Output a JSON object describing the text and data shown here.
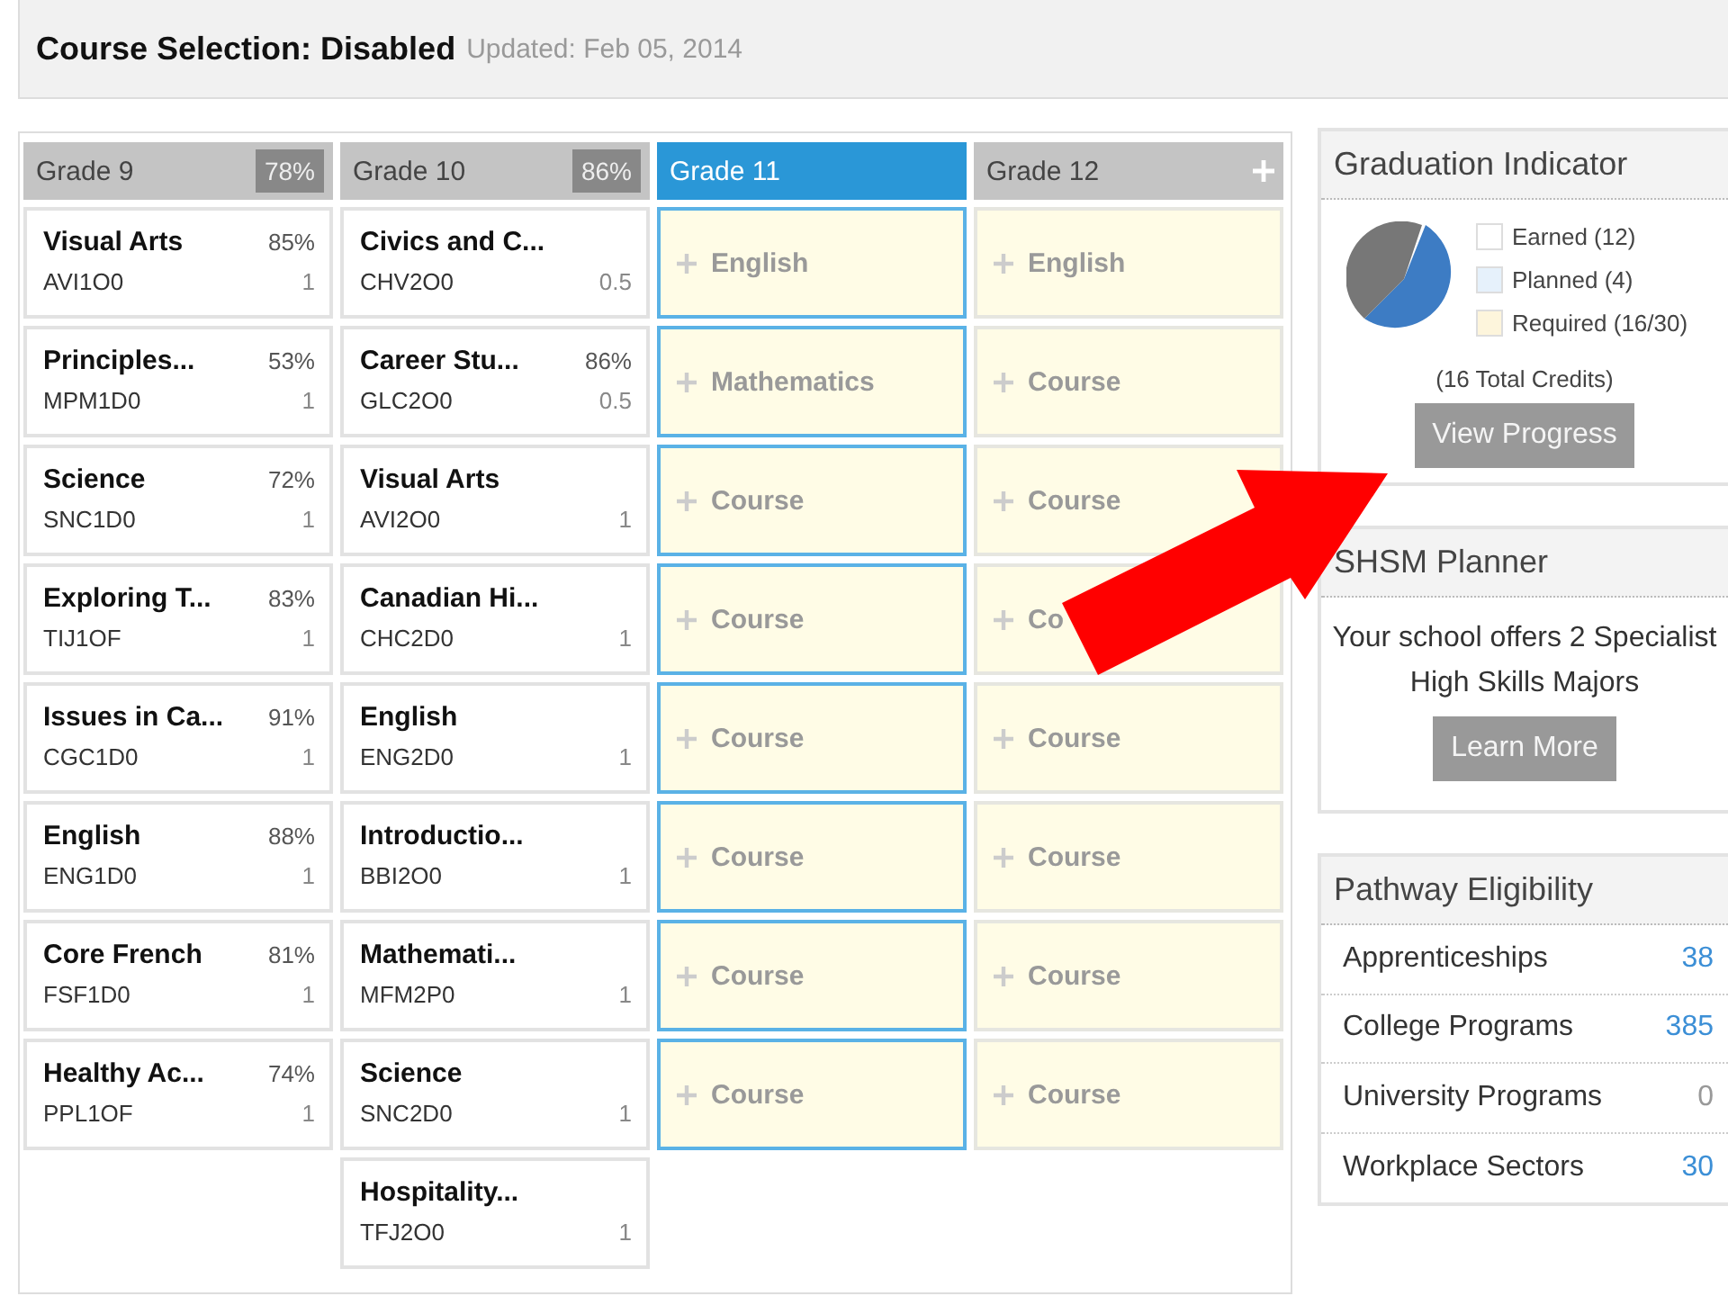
{
  "header": {
    "title": "Course Selection: Disabled",
    "updated": "Updated: Feb 05, 2014"
  },
  "grades": [
    {
      "label": "Grade 9",
      "percent": "78%",
      "selected": false,
      "can_add": false,
      "courses": [
        {
          "kind": "course",
          "name": "Visual Arts",
          "mark": "85%",
          "code": "AVI1O0",
          "credit": "1"
        },
        {
          "kind": "course",
          "name": "Principles...",
          "mark": "53%",
          "code": "MPM1D0",
          "credit": "1"
        },
        {
          "kind": "course",
          "name": "Science",
          "mark": "72%",
          "code": "SNC1D0",
          "credit": "1"
        },
        {
          "kind": "course",
          "name": "Exploring T...",
          "mark": "83%",
          "code": "TIJ1OF",
          "credit": "1"
        },
        {
          "kind": "course",
          "name": "Issues in Ca...",
          "mark": "91%",
          "code": "CGC1D0",
          "credit": "1"
        },
        {
          "kind": "course",
          "name": "English",
          "mark": "88%",
          "code": "ENG1D0",
          "credit": "1"
        },
        {
          "kind": "course",
          "name": "Core French",
          "mark": "81%",
          "code": "FSF1D0",
          "credit": "1"
        },
        {
          "kind": "course",
          "name": "Healthy Ac...",
          "mark": "74%",
          "code": "PPL1OF",
          "credit": "1"
        }
      ]
    },
    {
      "label": "Grade 10",
      "percent": "86%",
      "selected": false,
      "can_add": false,
      "courses": [
        {
          "kind": "course",
          "name": "Civics and C...",
          "code": "CHV2O0",
          "credit": "0.5"
        },
        {
          "kind": "course",
          "name": "Career Stu...",
          "mark": "86%",
          "code": "GLC2O0",
          "credit": "0.5"
        },
        {
          "kind": "course",
          "name": "Visual Arts",
          "code": "AVI2O0",
          "credit": "1"
        },
        {
          "kind": "course",
          "name": "Canadian Hi...",
          "code": "CHC2D0",
          "credit": "1"
        },
        {
          "kind": "course",
          "name": "English",
          "code": "ENG2D0",
          "credit": "1"
        },
        {
          "kind": "course",
          "name": "Introductio...",
          "code": "BBI2O0",
          "credit": "1"
        },
        {
          "kind": "course",
          "name": "Mathemati...",
          "code": "MFM2P0",
          "credit": "1"
        },
        {
          "kind": "course",
          "name": "Science",
          "code": "SNC2D0",
          "credit": "1"
        },
        {
          "kind": "course",
          "name": "Hospitality...",
          "code": "TFJ2O0",
          "credit": "1"
        }
      ]
    },
    {
      "label": "Grade 11",
      "selected": true,
      "can_add": false,
      "courses": [
        {
          "kind": "slot",
          "label": "English"
        },
        {
          "kind": "slot",
          "label": "Mathematics"
        },
        {
          "kind": "slot",
          "label": "Course"
        },
        {
          "kind": "slot",
          "label": "Course"
        },
        {
          "kind": "slot",
          "label": "Course"
        },
        {
          "kind": "slot",
          "label": "Course"
        },
        {
          "kind": "slot",
          "label": "Course"
        },
        {
          "kind": "slot",
          "label": "Course"
        }
      ]
    },
    {
      "label": "Grade 12",
      "selected": false,
      "can_add": true,
      "courses": [
        {
          "kind": "slot",
          "label": "English"
        },
        {
          "kind": "slot",
          "label": "Course"
        },
        {
          "kind": "slot",
          "label": "Course"
        },
        {
          "kind": "slot",
          "label": "Co"
        },
        {
          "kind": "slot",
          "label": "Course"
        },
        {
          "kind": "slot",
          "label": "Course"
        },
        {
          "kind": "slot",
          "label": "Course"
        },
        {
          "kind": "slot",
          "label": "Course"
        }
      ]
    }
  ],
  "graduation_indicator": {
    "title": "Graduation Indicator",
    "legend": [
      {
        "label": "Earned (12)",
        "color": "#ffffff"
      },
      {
        "label": "Planned (4)",
        "color": "#e6f1fb"
      },
      {
        "label": "Required (16/30)",
        "color": "#fdf5dc"
      }
    ],
    "total": "(16 Total Credits)",
    "button": "View Progress"
  },
  "shsm_planner": {
    "title": "SHSM Planner",
    "text": "Your school offers 2 Specialist High Skills Majors",
    "button": "Learn More"
  },
  "pathway_eligibility": {
    "title": "Pathway Eligibility",
    "items": [
      {
        "label": "Apprenticeships",
        "count": "38",
        "color": "#3c8fd6"
      },
      {
        "label": "College Programs",
        "count": "385",
        "color": "#3c8fd6"
      },
      {
        "label": "University Programs",
        "count": "0",
        "color": "#999999"
      },
      {
        "label": "Workplace Sectors",
        "count": "30",
        "color": "#3c8fd6"
      }
    ]
  }
}
